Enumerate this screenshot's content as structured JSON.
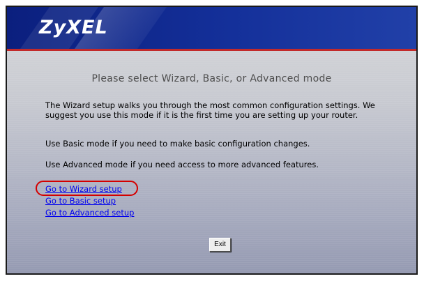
{
  "header": {
    "logo_text": "ZyXEL"
  },
  "colors": {
    "header_blue": "#0b1f7e",
    "accent_red": "#c22a2a",
    "highlight_red": "#d40000",
    "link_blue": "#0000ee"
  },
  "main": {
    "title": "Please select Wizard, Basic, or Advanced mode",
    "paragraphs": [
      "The Wizard setup walks you through the most common configuration settings. We suggest you use this mode if it is the first time you are setting up your router.",
      "Use Basic mode if you need to make basic configuration changes.",
      "Use Advanced mode if you need access to more advanced features."
    ],
    "links": [
      {
        "label": "Go to Wizard setup",
        "highlighted": true
      },
      {
        "label": "Go to Basic setup"
      },
      {
        "label": "Go to Advanced setup"
      }
    ],
    "exit_label": "Exit"
  }
}
